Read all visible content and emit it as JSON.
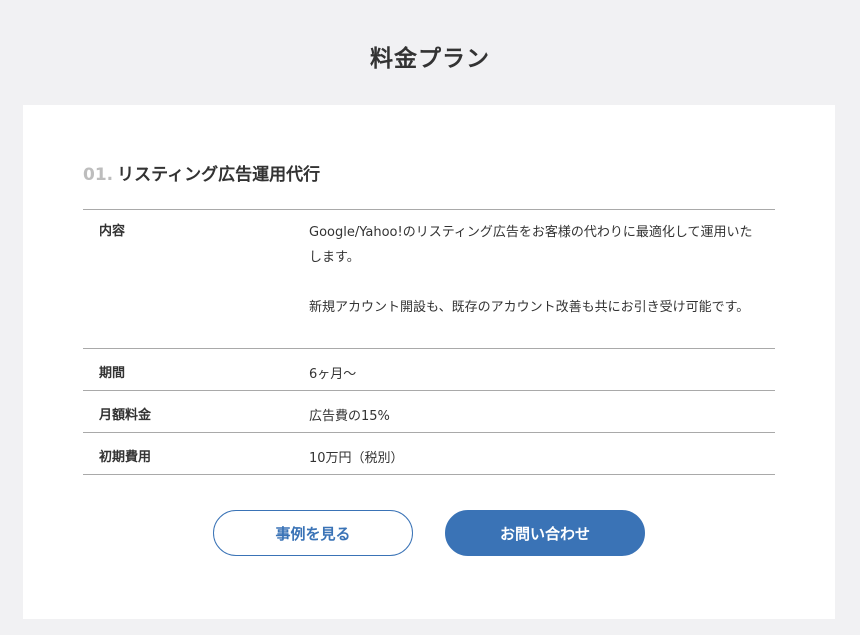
{
  "page": {
    "title": "料金プラン"
  },
  "plan": {
    "number": "01.",
    "name": "リスティング広告運用代行",
    "rows": [
      {
        "label": "内容",
        "value_lines": [
          "Google/Yahoo!のリスティング広告をお客様の代わりに最適化して運用いたします。",
          "新規アカウント開設も、既存のアカウント改善も共にお引き受け可能です。"
        ]
      },
      {
        "label": "期間",
        "value": "6ヶ月〜"
      },
      {
        "label": "月額料金",
        "value": "広告費の15%"
      },
      {
        "label": "初期費用",
        "value": "10万円（税別）"
      }
    ]
  },
  "buttons": {
    "cases_label": "事例を見る",
    "contact_label": "お問い合わせ"
  },
  "colors": {
    "accent": "#3a73b6",
    "background": "#f1f1f3",
    "card": "#ffffff"
  }
}
